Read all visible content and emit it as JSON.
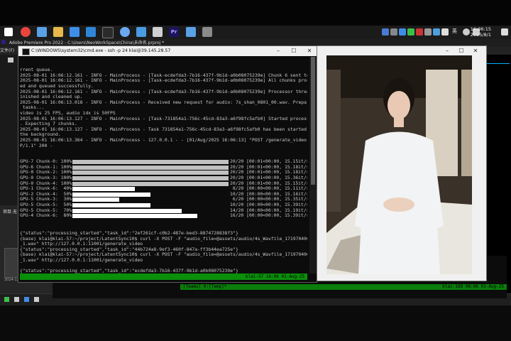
{
  "taskbar": {
    "icons": [
      {
        "name": "start-icon",
        "color": "#ffffff"
      },
      {
        "name": "chrome-icon",
        "color": "#e8453c"
      },
      {
        "name": "files-icon",
        "color": "#5aa0e6"
      },
      {
        "name": "folder-icon",
        "color": "#e8b84a"
      },
      {
        "name": "store-icon",
        "color": "#3d8ee8"
      },
      {
        "name": "vscode-icon",
        "color": "#2f86d8"
      },
      {
        "name": "terminal-icon",
        "color": "#2b2b2b"
      },
      {
        "name": "network-icon",
        "color": "#6aa9f0"
      },
      {
        "name": "notes-icon",
        "color": "#4a9be0"
      },
      {
        "name": "app-icon",
        "color": "#d0d0d0"
      },
      {
        "name": "premiere-icon",
        "color": "#1b1560"
      },
      {
        "name": "image-icon",
        "color": "#5aa0e6"
      },
      {
        "name": "tool-icon",
        "color": "#8a8a8a"
      }
    ],
    "tray_lang": "英",
    "clock_time": "16:06:15",
    "clock_date": "2025/8/1"
  },
  "premiere": {
    "title": "Adobe Premiere Pro 2022 - C:\\Users\\NeoWorkSpace\\China\\未命名.prproj *",
    "menu_first": "文件(F)",
    "project_label": "项目:无",
    "thumb_caption": "2024-12-23 12:04:56"
  },
  "cmd": {
    "title": "C:\\WINDOWS\\system32\\cmd.exe - ssh -p 24 klai@39.145.28.57",
    "controls": [
      "–",
      "☐",
      "✕"
    ],
    "lines": [
      "rrent queue.",
      "2025-08-01 16:06:12.161 - INFO - MainProcess - [Task-ecdefda3-7b16-437f-9b1d-a0b08075239e] Chunk 6 sent to st",
      "2025-08-01 16:06:12.161 - INFO - MainProcess - [Task-ecdefda3-7b16-437f-9b1d-a0b08075239e] All chunks process",
      "ed and queued successfully.",
      "2025-08-01 16:06:12.161 - INFO - MainProcess - [Task-ecdefda3-7b16-437f-9b1d-a0b08075239e] Processor thread f",
      "inished and cleaned up.",
      "2025-08-01 16:06:13.018 - INFO - MainProcess - Received new request for audio: 7s_shan_0801_00.wav. Preparing",
      " tasks...",
      "video is 25 FPS, audio idx is 50FPS",
      "2025-08-01 16:06:13.127 - INFO - MainProcess - [Task-731854a1-756c-45cd-83a3-a6f98fc5afb0] Started processing",
      ". Expecting 7 chunks.",
      "2025-08-01 16:06:13.127 - INFO - MainProcess - Task 731854a1-756c-45cd-83a3-a6f98fc5afb0 has been started in",
      "the background.",
      "2025-08-01 16:06:13.364 - INFO - MainProcess - 127.0.0.1 - - [01/Aug/2025 16:06:13] \"POST /generate_video HTT",
      "P/1.1\" 200 -"
    ],
    "gpu_rows": [
      {
        "label": "GPU-7 Chunk-0: 100%",
        "fill": 1.0,
        "right": "20/20 [00:01<00:00, 15.15it/s]"
      },
      {
        "label": "GPU-6 Chunk-1: 100%",
        "fill": 1.0,
        "right": "20/20 [00:01<00:00, 15.18it/s]"
      },
      {
        "label": "GPU-0 Chunk-2: 100%",
        "fill": 1.0,
        "right": "20/20 [00:01<00:00, 15.18it/s]"
      },
      {
        "label": "GPU-0 Chunk-3: 100%",
        "fill": 1.0,
        "right": "20/20 [00:01<00:00, 15.36it/s]"
      },
      {
        "label": "GPU-0 Chunk-4: 100%",
        "fill": 1.0,
        "right": "20/20 [00:01<00:00, 15.15it/s]"
      },
      {
        "label": "GPU-1 Chunk-6:  40%",
        "fill": 0.4,
        "right": " 8/20 [00:00<00:00, 15.11it/s]"
      },
      {
        "label": "GPU-2 Chunk-4:  50%",
        "fill": 0.5,
        "right": "10/20 [00:00<00:00, 15.16it/s]"
      },
      {
        "label": "GPU-5 Chunk-3:  30%",
        "fill": 0.3,
        "right": " 6/20 [00:00<00:00, 15.35it/s]"
      },
      {
        "label": "GPU-5 Chunk-5:  50%",
        "fill": 0.5,
        "right": "10/20 [00:00<00:00, 15.39it/s]"
      },
      {
        "label": "GPU-5 Chunk-5:  70%",
        "fill": 0.7,
        "right": "14/20 [00:00<00:00, 15.19it/s]"
      },
      {
        "label": "GPU-4 Chunk-6:  80%",
        "fill": 0.8,
        "right": "16/20 [00:00<00:00, 15.39it/s]"
      }
    ],
    "status_right": "klai-57  16:06 01-Aug-25"
  },
  "cmd2": {
    "lines": [
      "{\"status\":\"processing_started\",\"task_id\":\"2ef261cf-c0b2-487e-bed3-8874728838f3\"}",
      "(base) klai@klai-57:~/project/LatentSync10$ curl -X POST -F \"audio_file=@assets/audio/4s_Wavfile_1719704064_1",
      "_1.wav\" http://127.0.0.1:11001/generate_video",
      "{\"status\":\"processing_started\",\"task_id\":\"44b724a8-9ef3-460f-847a-ff3b44ea725e\"}",
      "(base) klai@klai-57:~/project/LatentSync10$ curl -X POST -F \"audio_file=@assets/audio/4s_Wavfile_1719704064_1",
      "_1.wav\" http://127.0.0.1:11001/generate_video",
      "",
      "{\"status\":\"processing_started\",\"task_id\":\"ecdefda3-7b16-437f-9b1d-a0b08075239e\"}",
      "(base) klai@klai-57:~/project/LatentSync10$ curl -X POST -F \"audio_file=@assets/audio/7s_shan_0801_00.wav\" ht",
      "tp://127.0.0.1:11001/generate_video",
      "{\"status\":\"processing_started\",\"task_id\":\"731854a1-756c-45cd-83a3-a6f98fc5afb0\"}",
      "(base) klai@klai-57:~/project/LatentSync10$"
    ],
    "status_left": "[Teams] 0:[Temp]*",
    "status_right": "klai-188  08:06 01-Aug-25"
  }
}
